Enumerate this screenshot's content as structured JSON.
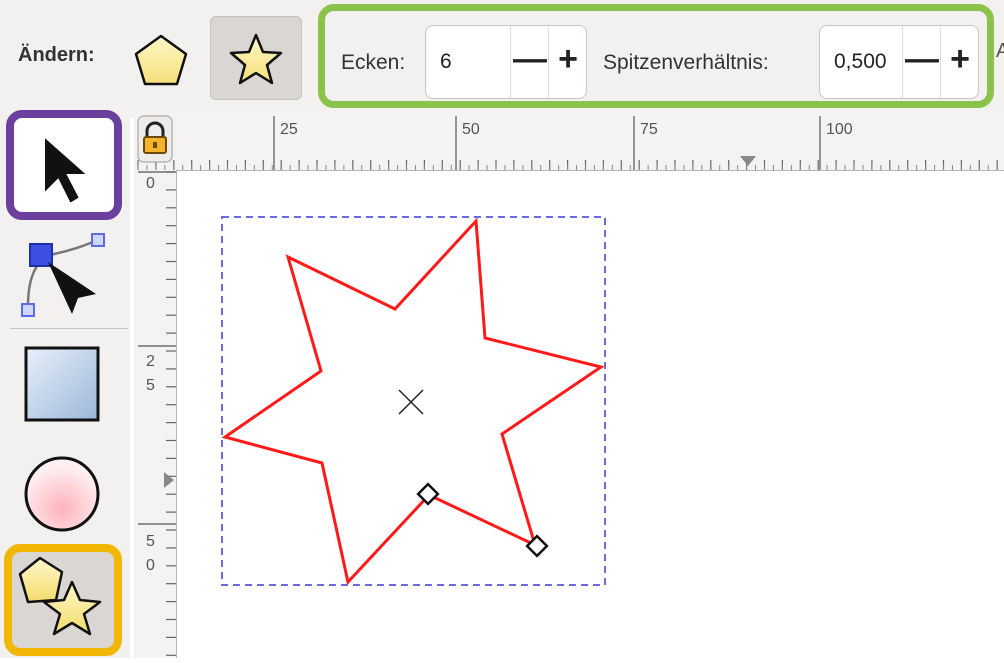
{
  "toolbar": {
    "change_label": "Ändern:",
    "polygon_button": "polygon-mode",
    "star_button": "star-mode",
    "corners_label": "Ecken:",
    "corners_value": "6",
    "ratio_label": "Spitzenverhältnis:",
    "ratio_value": "0,500",
    "minus_glyph": "—",
    "plus_glyph": "+",
    "edge_glyph": "A"
  },
  "ruler": {
    "top_labels": [
      "25",
      "50",
      "75",
      "100"
    ],
    "left_labels": [
      {
        "text": "0"
      },
      {
        "text": "2"
      },
      {
        "text": "5"
      },
      {
        "text": "5"
      },
      {
        "text": "0"
      }
    ]
  },
  "tools": [
    "selector-tool",
    "node-tool",
    "rectangle-tool",
    "ellipse-tool",
    "star-polygon-tool"
  ],
  "colors": {
    "toolbar_bg": "#f2f1f0",
    "params_highlight": "#8bc34a",
    "selector_highlight": "#6a3f9e",
    "star_tool_highlight": "#f2b705",
    "star_stroke": "#ff1a1a",
    "bbox_dash": "#6b6bdf"
  }
}
